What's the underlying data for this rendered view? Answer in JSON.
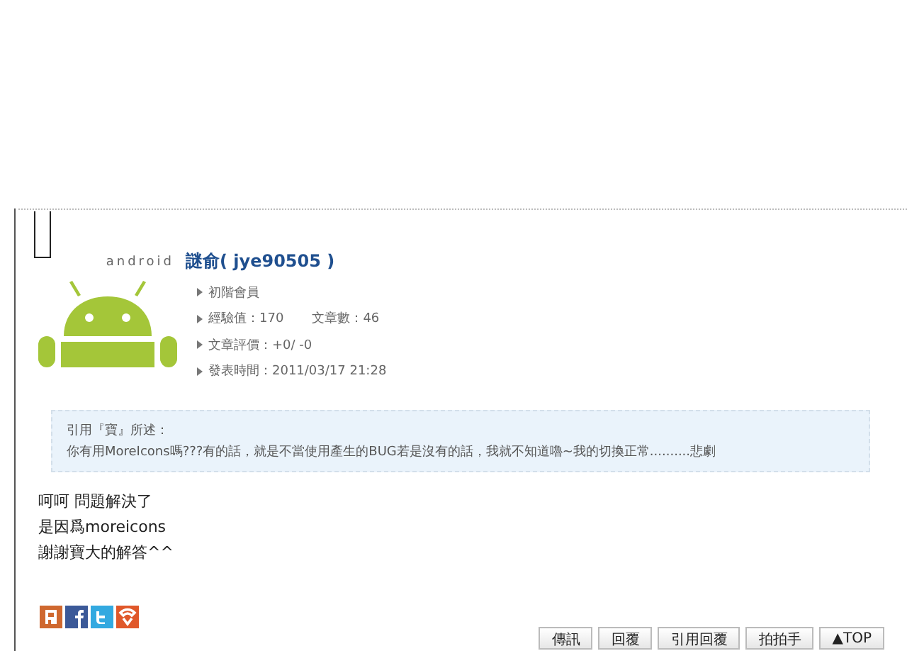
{
  "author": {
    "logo_text": "android",
    "name": "謎俞( jye90505 )",
    "details": [
      [
        "初階會員"
      ],
      [
        "經驗值：170",
        "文章數：46"
      ],
      [
        "文章評價：+0/ -0"
      ],
      [
        "發表時間：2011/03/17 21:28"
      ]
    ]
  },
  "quote": {
    "heading": "引用『寶』所述：",
    "text": "你有用MoreIcons嗎???有的話，就是不當使用產生的BUG若是沒有的話，我就不知道嚕~我的切換正常..........悲劇"
  },
  "body": [
    "呵呵 問題解決了",
    "是因爲moreicons",
    "謝謝寶大的解答^^"
  ],
  "share_icons": [
    {
      "kind": "plurk"
    },
    {
      "kind": "facebook"
    },
    {
      "kind": "twitter"
    },
    {
      "kind": "other"
    }
  ],
  "buttons": [
    "傳訊",
    "回覆",
    "引用回覆",
    "拍拍手",
    "▲TOP"
  ]
}
